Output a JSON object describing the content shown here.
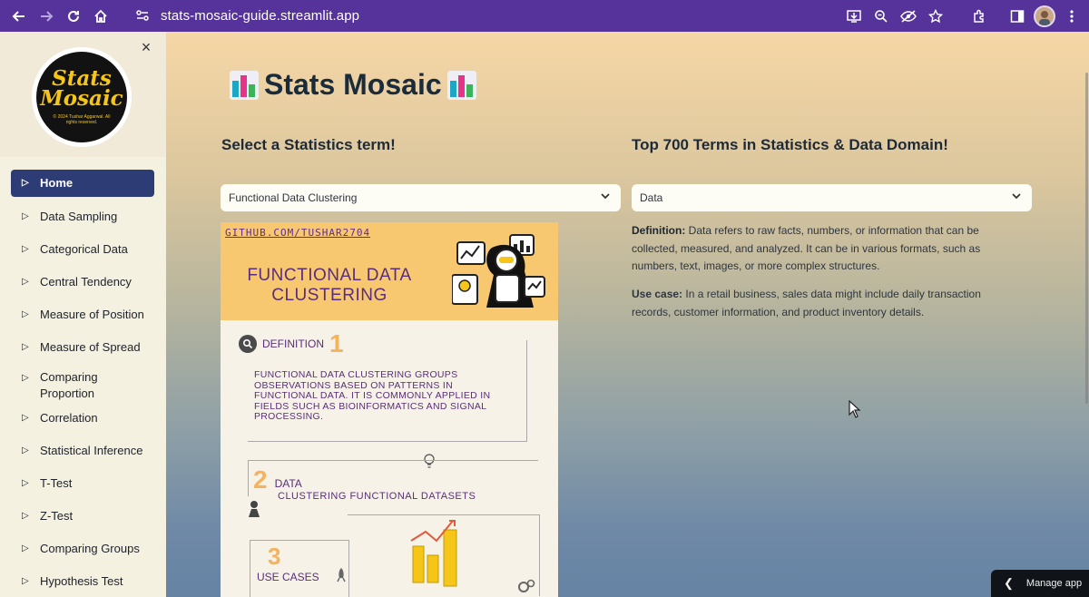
{
  "browser": {
    "url": "stats-mosaic-guide.streamlit.app",
    "icons": [
      "back-arrow-icon",
      "forward-arrow-icon",
      "reload-icon",
      "home-icon",
      "site-settings-icon",
      "install-app-icon",
      "zoom-icon",
      "eye-off-icon",
      "bookmark-star-icon",
      "extensions-icon",
      "side-panel-icon",
      "profile-avatar",
      "more-menu-icon"
    ]
  },
  "sidebar": {
    "logo": {
      "line1": "Stats",
      "line2": "Mosaic",
      "copyright": "© 2024 Tushar Aggarwal. All rights reserved."
    },
    "close_label": "×",
    "items": [
      {
        "label": "Home",
        "active": true
      },
      {
        "label": "Data Sampling"
      },
      {
        "label": "Categorical Data"
      },
      {
        "label": "Central Tendency"
      },
      {
        "label": "Measure of Position"
      },
      {
        "label": "Measure of Spread"
      },
      {
        "label": "Comparing Proportion"
      },
      {
        "label": "Correlation"
      },
      {
        "label": "Statistical Inference"
      },
      {
        "label": "T-Test"
      },
      {
        "label": "Z-Test"
      },
      {
        "label": "Comparing Groups"
      },
      {
        "label": "Hypothesis Test"
      }
    ]
  },
  "main": {
    "title": "Stats Mosaic",
    "left_heading": "Select a Statistics term!",
    "right_heading": "Top 700 Terms in Statistics & Data Domain!",
    "left_select": "Functional Data Clustering",
    "right_select": "Data",
    "definition_label": "Definition:",
    "definition_text": "Data refers to raw facts, numbers, or information that can be collected, measured, and analyzed. It can be in various formats, such as numbers, text, images, or more complex structures.",
    "usecase_label": "Use case:",
    "usecase_text": "In a retail business, sales data might include daily transaction records, customer information, and product inventory details.",
    "colors": {
      "active_nav": "#2d3c75",
      "heading": "#1a2b3c"
    }
  },
  "infographic": {
    "github": "GITHUB.COM/TUSHAR2704",
    "title": "FUNCTIONAL DATA CLUSTERING",
    "definition_heading": "DEFINITION",
    "definition_number": "1",
    "definition_text": "Functional data clustering groups observations based on patterns in functional data. It is commonly applied in fields such as bioinformatics and signal processing.",
    "data_number": "2",
    "data_heading": "DATA",
    "data_sub": "CLUSTERING FUNCTIONAL DATASETS",
    "usecase_number": "3",
    "usecase_heading": "USE CASES"
  },
  "footer": {
    "manage_app": "Manage app"
  }
}
